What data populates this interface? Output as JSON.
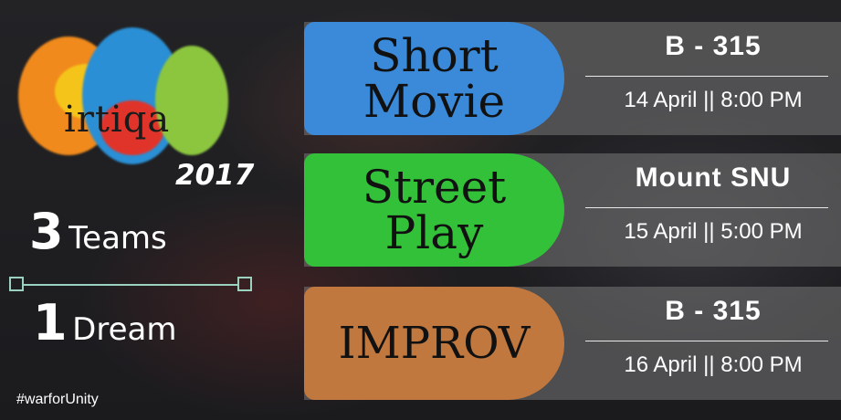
{
  "logo": {
    "word": "irtiqa",
    "year": "2017"
  },
  "tagline": {
    "count1": "3",
    "word1": "Teams",
    "count2": "1",
    "word2": "Dream"
  },
  "hashtag": "#warforUnity",
  "events": [
    {
      "name_line1": "Short",
      "name_line2": "Movie",
      "venue": "B - 315",
      "date": "14 April",
      "time": "8:00 PM",
      "color": "#3b8ad9"
    },
    {
      "name_line1": "Street",
      "name_line2": "Play",
      "venue": "Mount SNU",
      "date": "15 April",
      "time": "5:00 PM",
      "color": "#33c13a"
    },
    {
      "name_line1": "IMPROV",
      "name_line2": "",
      "venue": "B - 315",
      "date": "16 April",
      "time": "8:00 PM",
      "color": "#c0783f"
    }
  ],
  "separator": "||"
}
